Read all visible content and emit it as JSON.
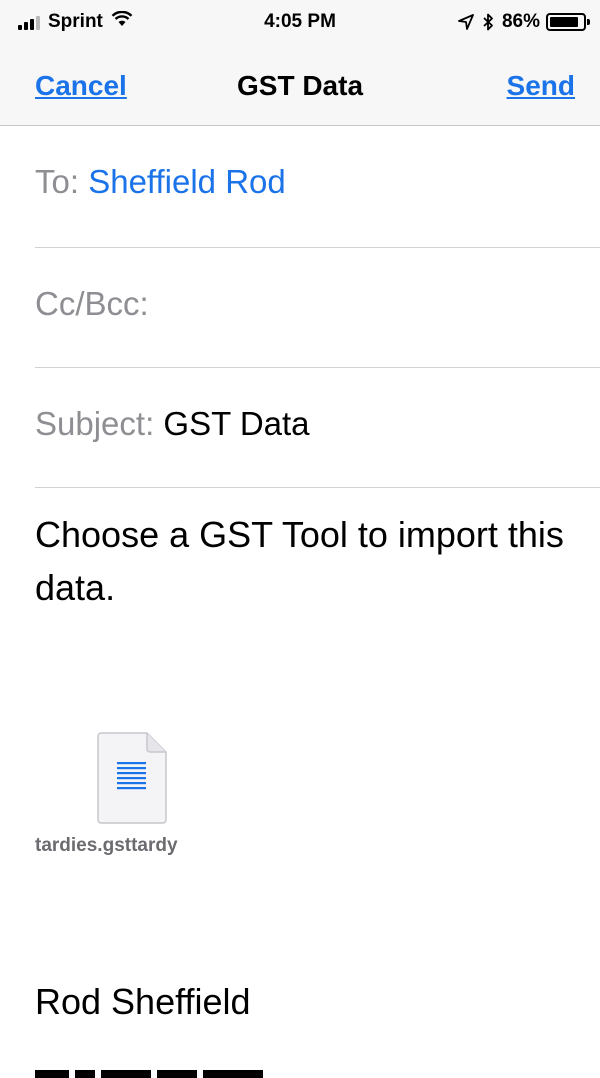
{
  "status_bar": {
    "carrier": "Sprint",
    "time": "4:05 PM",
    "battery_percent": "86%",
    "battery_level": 0.86
  },
  "nav": {
    "cancel_label": "Cancel",
    "title": "GST Data",
    "send_label": "Send"
  },
  "fields": {
    "to_label": "To:",
    "to_value": "Sheffield Rod",
    "cc_label": "Cc/Bcc:",
    "subject_label": "Subject:",
    "subject_value": "GST Data"
  },
  "body": {
    "message": "Choose a GST Tool to import this data.",
    "attachment_name": "tardies.gsttardy",
    "signature": "Rod Sheffield"
  },
  "colors": {
    "accent": "#1a73e8",
    "label_gray": "#8e8e93",
    "bar_background": "#f7f7f7"
  },
  "icons": {
    "signal": "cellular-signal-icon",
    "wifi": "wifi-icon",
    "location": "location-arrow-icon",
    "bluetooth": "bluetooth-icon",
    "battery": "battery-icon",
    "attachment": "document-icon"
  }
}
